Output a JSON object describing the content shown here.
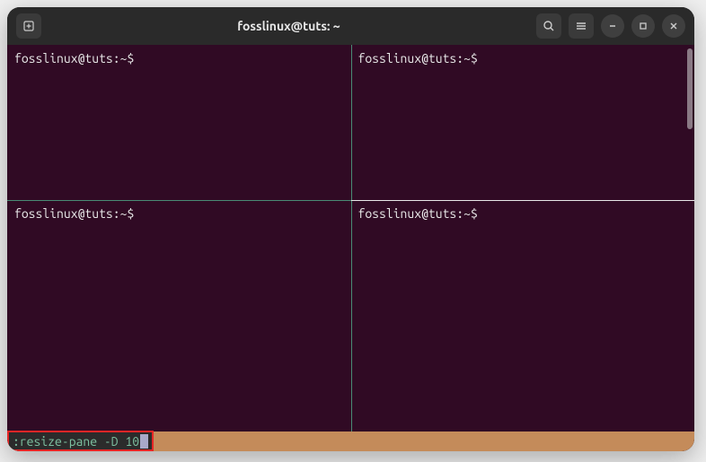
{
  "window": {
    "title": "fosslinux@tuts: ~"
  },
  "titlebar": {
    "new_tab_tooltip": "New Tab",
    "search_tooltip": "Search",
    "menu_tooltip": "Menu",
    "minimize_tooltip": "Minimize",
    "maximize_tooltip": "Maximize",
    "close_tooltip": "Close"
  },
  "panes": [
    {
      "prompt": "fosslinux@tuts:~$"
    },
    {
      "prompt": "fosslinux@tuts:~$"
    },
    {
      "prompt": "fosslinux@tuts:~$"
    },
    {
      "prompt": "fosslinux@tuts:~$"
    }
  ],
  "status": {
    "command": ":resize-pane -D 10"
  }
}
